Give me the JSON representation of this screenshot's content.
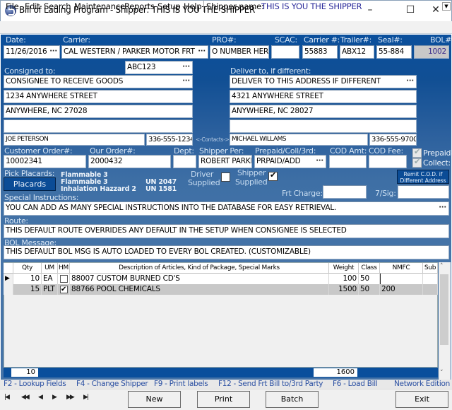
{
  "window": {
    "title": "Bill of Lading Program - Shipper: THIS IS YOU THE SHIPPER",
    "minimize": "–",
    "maximize": "☐",
    "close": "✕"
  },
  "menu": {
    "items": [
      "File",
      "Edit",
      "Search",
      "Maintenance",
      "Reports",
      "Setup",
      "Help"
    ],
    "shipper_label": "Shipper name:",
    "shipper_value": "THIS IS YOU THE SHIPPER",
    "dropdown_icon": "▼"
  },
  "header": {
    "date_label": "Date:",
    "date": "11/26/2016",
    "carrier_label": "Carrier:",
    "carrier": "CAL WESTERN / PARKER MOTOR FRT",
    "pro_label": "PRO#:",
    "pro": "O NUMBER HERE",
    "scac_label": "SCAC:",
    "scac": "",
    "carrier_num_label": "Carrier #:",
    "carrier_num": "55883",
    "trailer_label": "Trailer#:",
    "trailer": "ABX12",
    "seal_label": "Seal#:",
    "seal": "55-884",
    "bol_label": "BOL#:",
    "bol": "1002",
    "lookup_icon": "···"
  },
  "consignee": {
    "label": "Consigned to:",
    "code": "ABC123",
    "name": "CONSIGNEE TO RECEIVE GOODS",
    "address1": "1234 ANYWHERE STREET",
    "city_state_zip": "ANYWHERE, NC 27028",
    "address3": "",
    "contact": "JOE PETERSON",
    "phone": "336-555-1234"
  },
  "contacts_label": "<-Contacts->",
  "deliver_to": {
    "label": "Deliver to, if different:",
    "name": "DELIVER TO THIS ADDRESS IF DIFFERENT",
    "address1": "4321 ANYWHERE STREET",
    "city_state_zip": "ANYWHERE, NC 28027",
    "address3": "",
    "contact": "MICHAEL WILLAMS",
    "phone": "336-555-9700"
  },
  "order": {
    "customer_order_label": "Customer Order#:",
    "customer_order": "10002341",
    "our_order_label": "Our Order#:",
    "our_order": "2000432",
    "dept_label": "Dept:",
    "dept": "",
    "shipper_per_label": "Shipper Per:",
    "shipper_per": "ROBERT PARKE",
    "prepaid_label": "Prepaid/Coll/3rd:",
    "prepaid": "PRPAID/ADD",
    "cod_amt_label": "COD Amt:",
    "cod_amt": "",
    "cod_fee_label": "COD Fee:",
    "cod_fee": "",
    "prepaid_check_label": "Prepaid:",
    "prepaid_checked": true,
    "collect_check_label": "Collect:",
    "collect_checked": true
  },
  "placards": {
    "label": "Pick Placards:",
    "button": "Placards",
    "items": [
      {
        "name": "Flammable 3",
        "un": ""
      },
      {
        "name": "Flammable 3",
        "un": "UN 2047"
      },
      {
        "name": "Inhalation Hazzard 2",
        "un": "UN 1581"
      }
    ],
    "driver_supplied_line1": "Driver",
    "driver_supplied_line2": "Supplied",
    "driver_supplied": false,
    "shipper_supplied_line1": "Shipper",
    "shipper_supplied_line2": "Supplied",
    "shipper_supplied": true,
    "remit_button_line1": "Remit C.O.D. if",
    "remit_button_line2": "Different Address",
    "frt_charge_label": "Frt Charge:",
    "frt_charge": "",
    "sig_label": "7/Sig:",
    "sig": ""
  },
  "special_instructions": {
    "label": "Special Instructions:",
    "value": "YOU CAN ADD AS MANY SPECIAL INSTRUCTIONS INTO THE DATABASE FOR EASY RETRIEVAL."
  },
  "route": {
    "label": "Route:",
    "value": "THIS DEFAULT ROUTE OVERRIDES ANY DEFAULT IN THE SETUP WHEN CONSIGNEE IS SELECTED"
  },
  "bol_message": {
    "label": "BOL Message:",
    "value": "THIS DEFAULT BOL MSG IS AUTO LOADED TO EVERY BOL CREATED. (CUSTOMIZABLE)"
  },
  "grid": {
    "columns": [
      "Qty",
      "UM",
      "HM",
      "Description of Articles, Kind of Package, Special Marks",
      "Weight",
      "Class",
      "NMFC",
      "Sub"
    ],
    "rows": [
      {
        "qty": "10",
        "um": "EA",
        "hm": false,
        "description": "88007 CUSTOM BURNED CD'S",
        "weight": "100",
        "class": "50",
        "nmfc": "",
        "sub": "",
        "current": true
      },
      {
        "qty": "15",
        "um": "PLT",
        "hm": true,
        "description": "88766 POOL CHEMICALS",
        "weight": "1500",
        "class": "50",
        "nmfc": "200",
        "sub": "",
        "current": false
      }
    ],
    "total_qty": "10",
    "total_weight": "1600",
    "row_pointer_icon": "▶",
    "scroll_up_icon": "˄",
    "scroll_down_icon": "˅"
  },
  "hotkeys": [
    "F2 - Lookup Fields",
    "F4 - Change Shipper",
    "F9 - Print labels",
    "F12 - Send Frt Bill to/3rd Party",
    "F6 - Load Bill",
    "Network Edition"
  ],
  "navigation": {
    "first": "|◀",
    "prev_page": "◀◀",
    "prev": "◀",
    "next": "▶",
    "next_page": "▶▶",
    "last": "▶|"
  },
  "buttons": {
    "new": "New",
    "print": "Print",
    "batch": "Batch",
    "exit": "Exit"
  }
}
